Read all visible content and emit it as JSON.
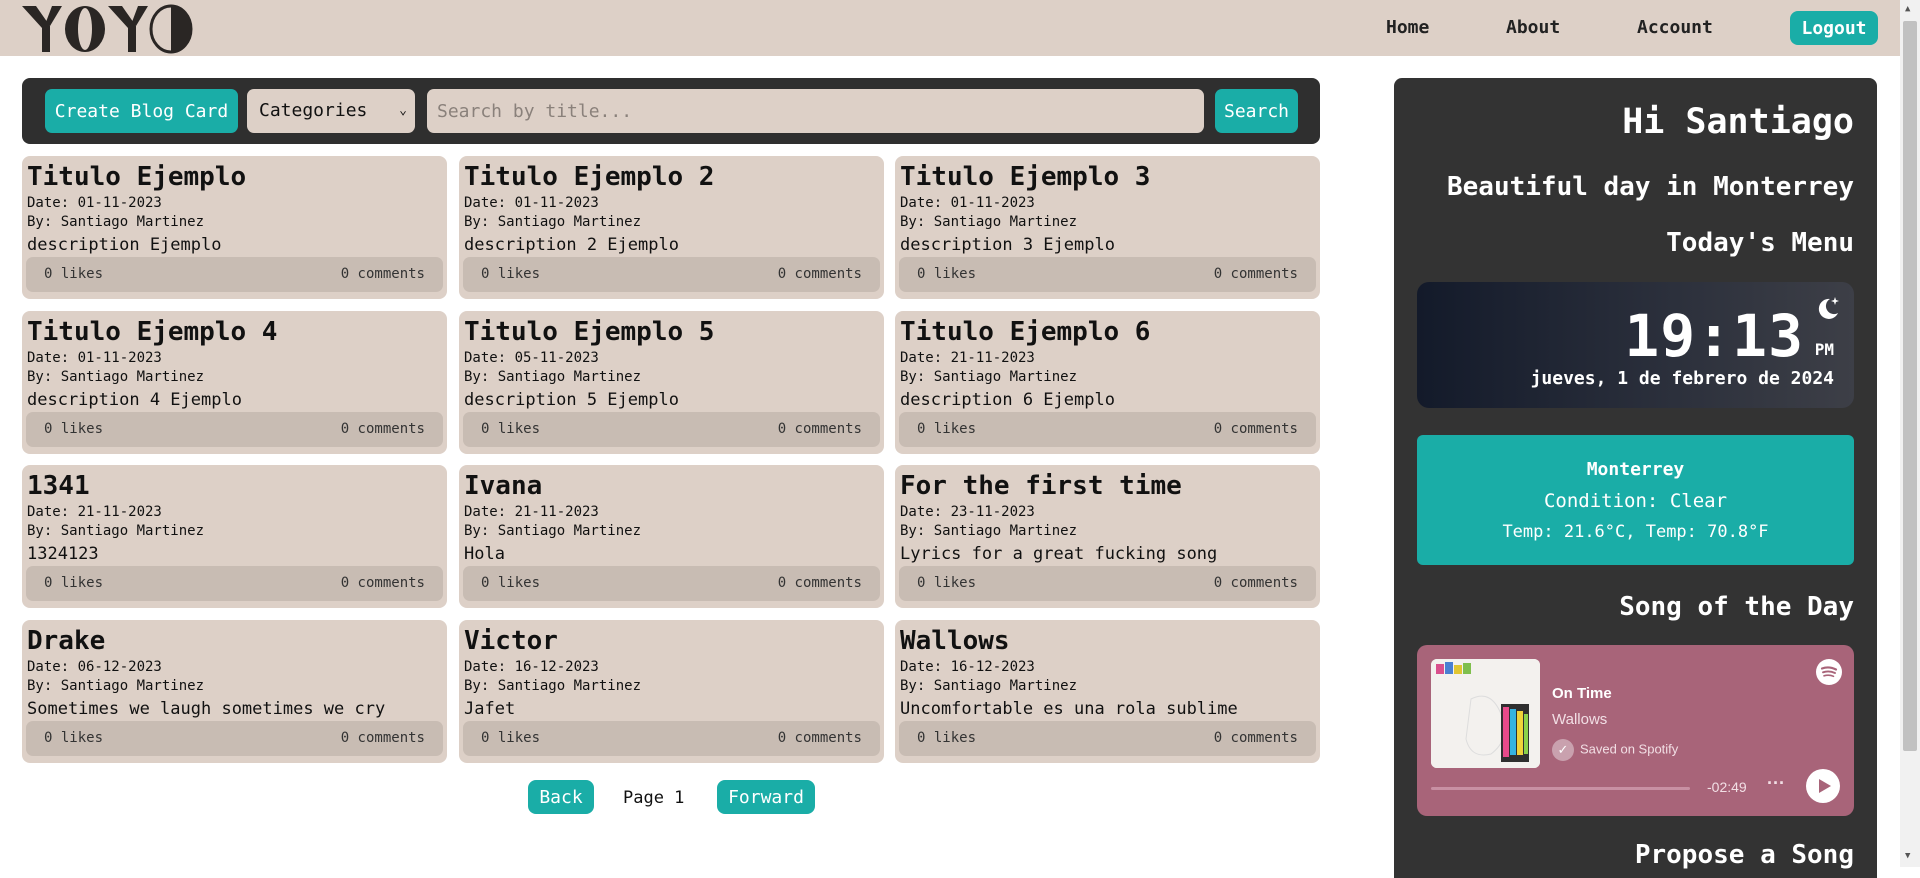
{
  "header": {
    "logo_text": "YOYO",
    "nav": [
      "Home",
      "About",
      "Account"
    ],
    "logout_label": "Logout"
  },
  "toolbar": {
    "create_label": "Create Blog Card",
    "category_selected": "Categories",
    "search_placeholder": "Search by title...",
    "search_label": "Search"
  },
  "cards": [
    {
      "title": "Titulo Ejemplo",
      "date": "Date: 01-11-2023",
      "author": "By: Santiago Martinez",
      "desc": "description Ejemplo",
      "likes": "0 likes",
      "comments": "0 comments"
    },
    {
      "title": "Titulo Ejemplo 2",
      "date": "Date: 01-11-2023",
      "author": "By: Santiago Martinez",
      "desc": "description 2 Ejemplo",
      "likes": "0 likes",
      "comments": "0 comments"
    },
    {
      "title": "Titulo Ejemplo 3",
      "date": "Date: 01-11-2023",
      "author": "By: Santiago Martinez",
      "desc": "description 3 Ejemplo",
      "likes": "0 likes",
      "comments": "0 comments"
    },
    {
      "title": "Titulo Ejemplo 4",
      "date": "Date: 01-11-2023",
      "author": "By: Santiago Martinez",
      "desc": "description 4 Ejemplo",
      "likes": "0 likes",
      "comments": "0 comments"
    },
    {
      "title": "Titulo Ejemplo 5",
      "date": "Date: 05-11-2023",
      "author": "By: Santiago Martinez",
      "desc": "description 5 Ejemplo",
      "likes": "0 likes",
      "comments": "0 comments"
    },
    {
      "title": "Titulo Ejemplo 6",
      "date": "Date: 21-11-2023",
      "author": "By: Santiago Martinez",
      "desc": "description 6 Ejemplo",
      "likes": "0 likes",
      "comments": "0 comments"
    },
    {
      "title": "1341",
      "date": "Date: 21-11-2023",
      "author": "By: Santiago Martinez",
      "desc": "1324123",
      "likes": "0 likes",
      "comments": "0 comments"
    },
    {
      "title": "Ivana",
      "date": "Date: 21-11-2023",
      "author": "By: Santiago Martinez",
      "desc": "Hola",
      "likes": "0 likes",
      "comments": "0 comments"
    },
    {
      "title": "For the first time",
      "date": "Date: 23-11-2023",
      "author": "By: Santiago Martinez",
      "desc": "Lyrics for a great fucking song",
      "likes": "0 likes",
      "comments": "0 comments"
    },
    {
      "title": "Drake",
      "date": "Date: 06-12-2023",
      "author": "By: Santiago Martinez",
      "desc": "Sometimes we laugh sometimes we cry",
      "likes": "0 likes",
      "comments": "0 comments"
    },
    {
      "title": "Victor",
      "date": "Date: 16-12-2023",
      "author": "By: Santiago Martinez",
      "desc": "Jafet",
      "likes": "0 likes",
      "comments": "0 comments"
    },
    {
      "title": "Wallows",
      "date": "Date: 16-12-2023",
      "author": "By: Santiago Martinez",
      "desc": "Uncomfortable es una rola sublime",
      "likes": "0 likes",
      "comments": "0 comments"
    }
  ],
  "pagination": {
    "back_label": "Back",
    "page_label": "Page 1",
    "forward_label": "Forward"
  },
  "panel": {
    "greeting": "Hi Santiago",
    "weather_line": "Beautiful day in Monterrey",
    "menu_title": "Today's Menu",
    "clock": {
      "time": "19:13",
      "ampm": "PM",
      "date": "jueves, 1 de febrero de 2024",
      "icon": "moon-stars-icon"
    },
    "weather": {
      "city": "Monterrey",
      "condition": "Condition: Clear",
      "temp": "Temp: 21.6°C, Temp: 70.8°F"
    },
    "song_title": "Song of the Day",
    "player": {
      "track": "On Time",
      "artist": "Wallows",
      "saved": "Saved on Spotify",
      "remaining": "-02:49",
      "progress": 0.0
    },
    "propose_title": "Propose a Song"
  },
  "colors": {
    "accent": "#1aada7",
    "card_bg": "#ddd0c7",
    "panel_bg": "#333333",
    "player_bg": "#a86479"
  }
}
